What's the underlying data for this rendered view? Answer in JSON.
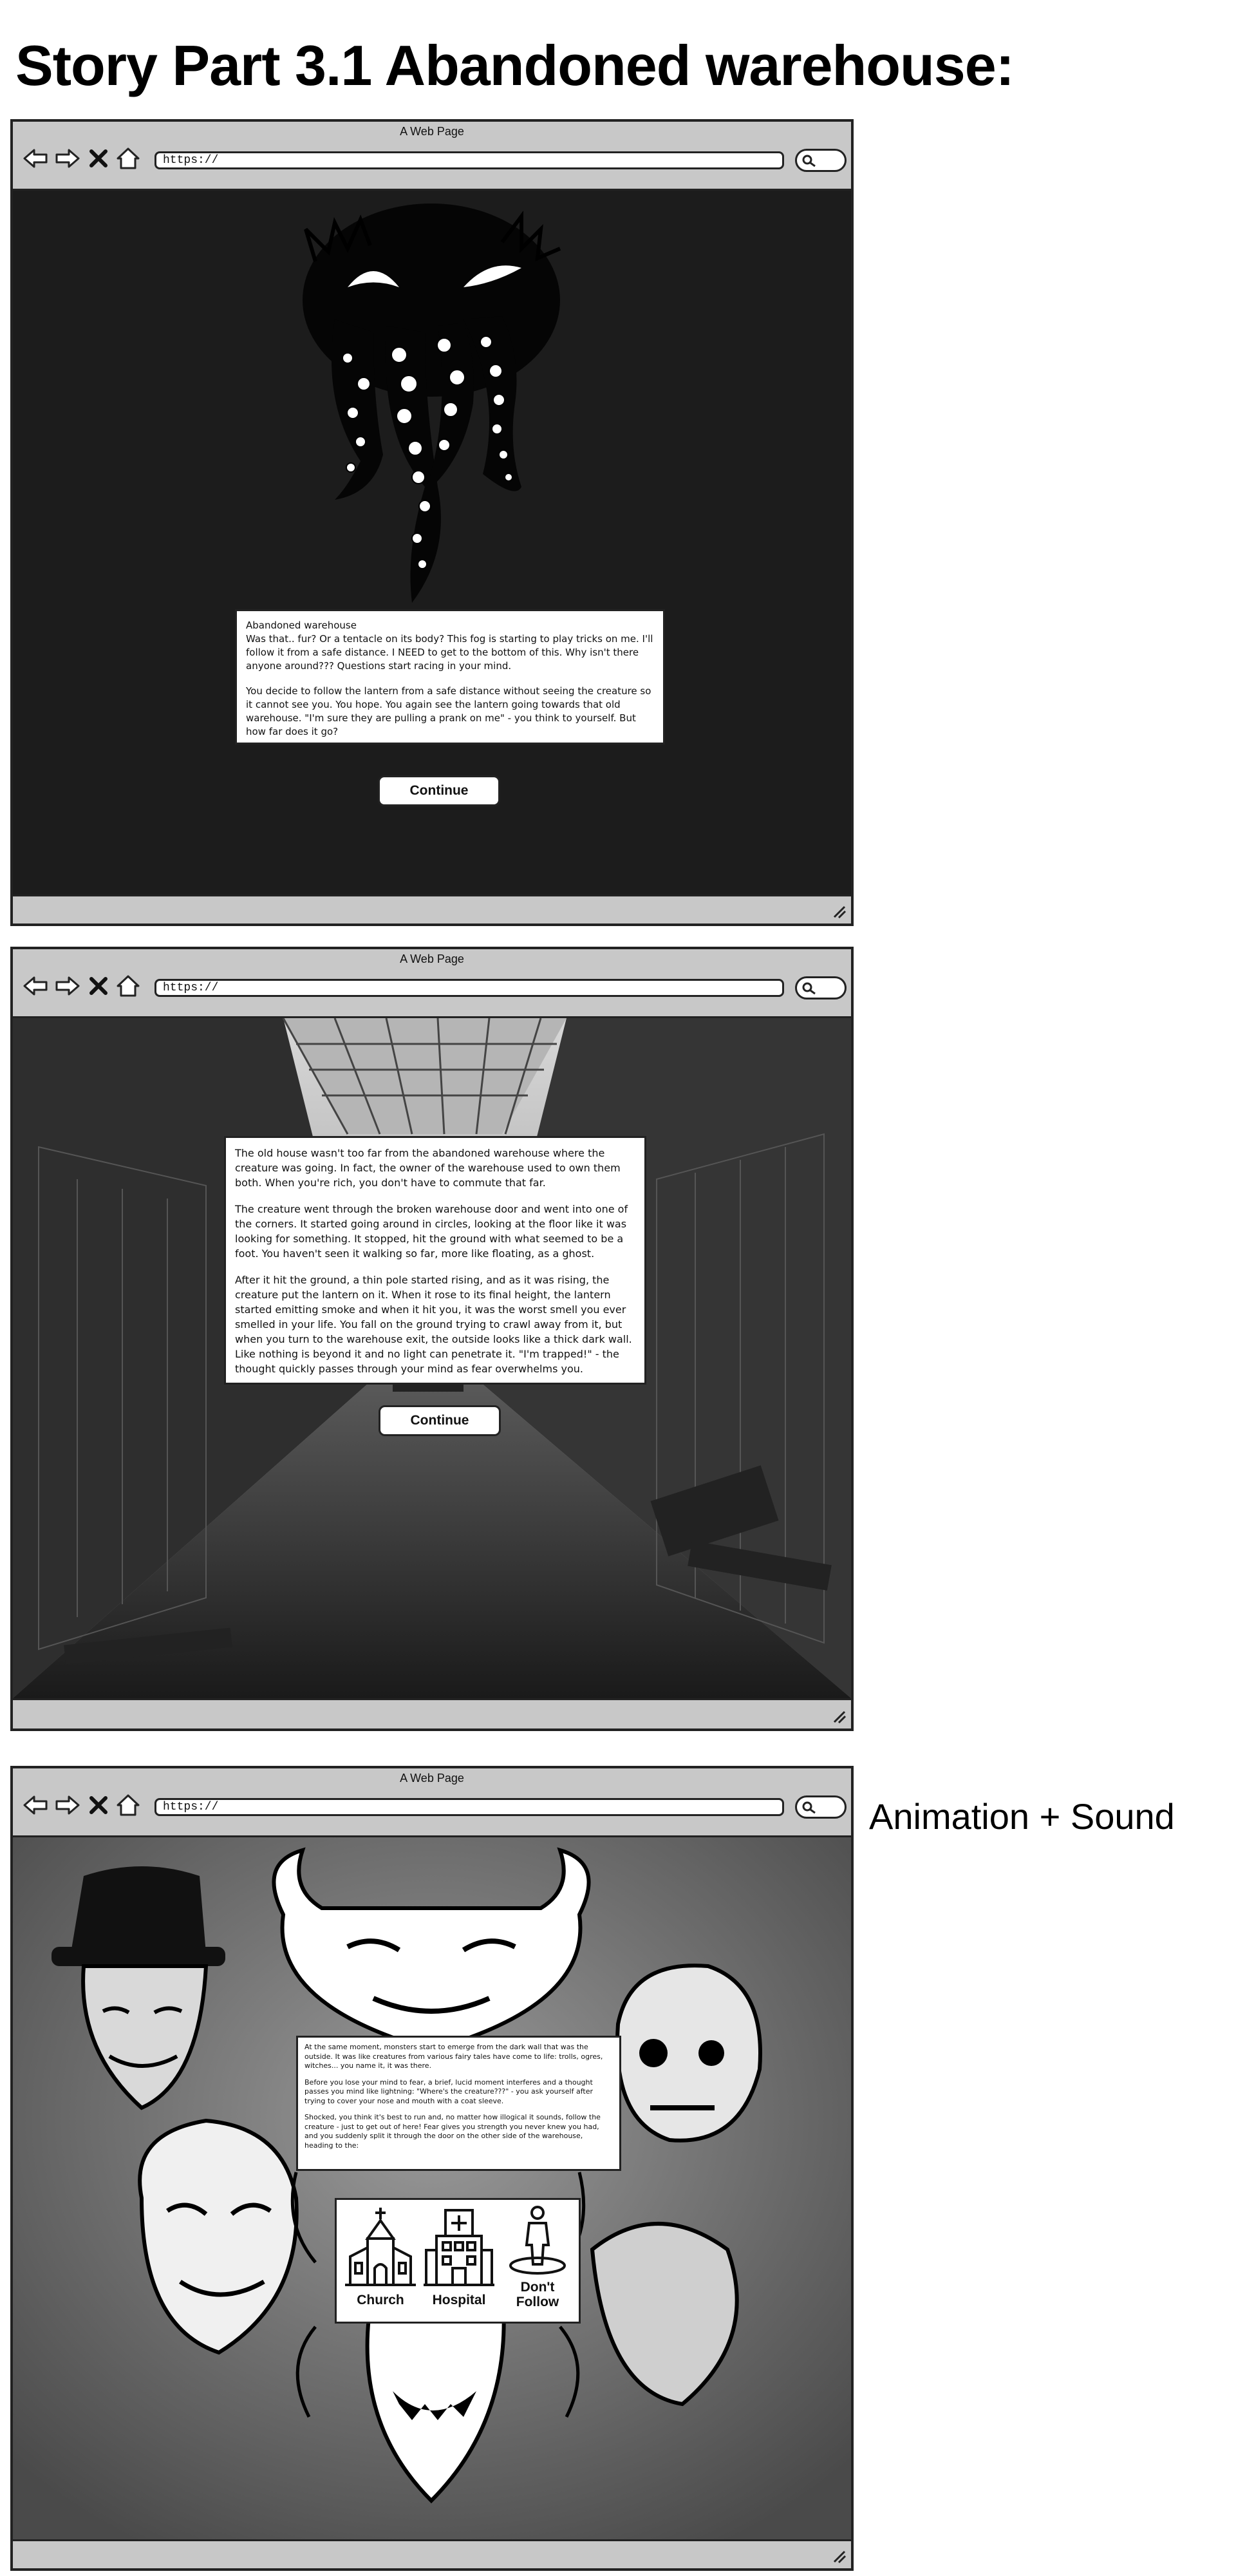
{
  "page": {
    "title": "Story Part 3.1 Abandoned warehouse:",
    "side_note": "Animation + Sound"
  },
  "browser": {
    "window_title": "A Web Page",
    "url": "https://"
  },
  "screen1": {
    "story_title": "Abandoned warehouse",
    "paragraphs": [
      "Was that.. fur? Or a tentacle on its body? This fog is starting to play tricks on me. I'll follow it from a safe distance. I NEED to get to the bottom of this. Why isn't there anyone around??? Questions start racing in your mind.",
      "You decide to follow the lantern from a safe distance without seeing the creature so it cannot see you. You hope. You again see the lantern going towards that old warehouse. \"I'm sure they are pulling a prank on me\" - you think to yourself. But how far does it go?"
    ],
    "continue_label": "Continue"
  },
  "screen2": {
    "paragraphs": [
      "The old house wasn't too far from the abandoned warehouse where the creature was going. In fact, the owner of the warehouse used to own them both. When you're rich, you don't have to commute that far.",
      "The creature went through the broken warehouse door and went into one of the corners. It started going around in circles, looking at the floor like it was looking for something. It stopped, hit the ground with what seemed to be a foot. You haven't seen it walking so far, more like floating, as a ghost.",
      "After it hit the ground, a thin pole started rising, and as it was rising, the creature put the lantern on it. When it rose to its final height, the lantern started emitting smoke and when it hit you, it was the worst smell you ever smelled in your life. You fall on the ground trying to crawl away from it, but when you turn to the warehouse exit, the outside looks like a thick dark wall. Like nothing is beyond it and no light can penetrate it. \"I'm trapped!\" - the thought quickly passes through your mind as fear overwhelms you."
    ],
    "continue_label": "Continue"
  },
  "screen3": {
    "paragraphs": [
      "At the same moment, monsters start to emerge from the dark wall that was the outside. It was like creatures from various fairy tales have come to life: trolls, ogres, witches... you name it, it was there.",
      "Before you lose your mind to fear, a brief, lucid moment interferes and a thought passes you mind like lightning: \"Where's the creature???\" - you ask yourself after trying to cover your nose and mouth with a coat sleeve.",
      "Shocked, you think it's best to run and, no matter how illogical it sounds, follow the creature - just to get out of here! Fear gives you strength you never knew you had, and you suddenly split it through the door on the other side of the warehouse, heading to the:"
    ],
    "choices": [
      {
        "label": "Church",
        "icon": "church-icon"
      },
      {
        "label": "Hospital",
        "icon": "hospital-icon"
      },
      {
        "label": "Don't Follow",
        "icon": "person-standing-icon"
      }
    ]
  },
  "colors": {
    "browser_chrome": "#c8c8c8",
    "outline": "#222222",
    "panel": "#ffffff",
    "dark_bg": "#1c1c1c"
  }
}
